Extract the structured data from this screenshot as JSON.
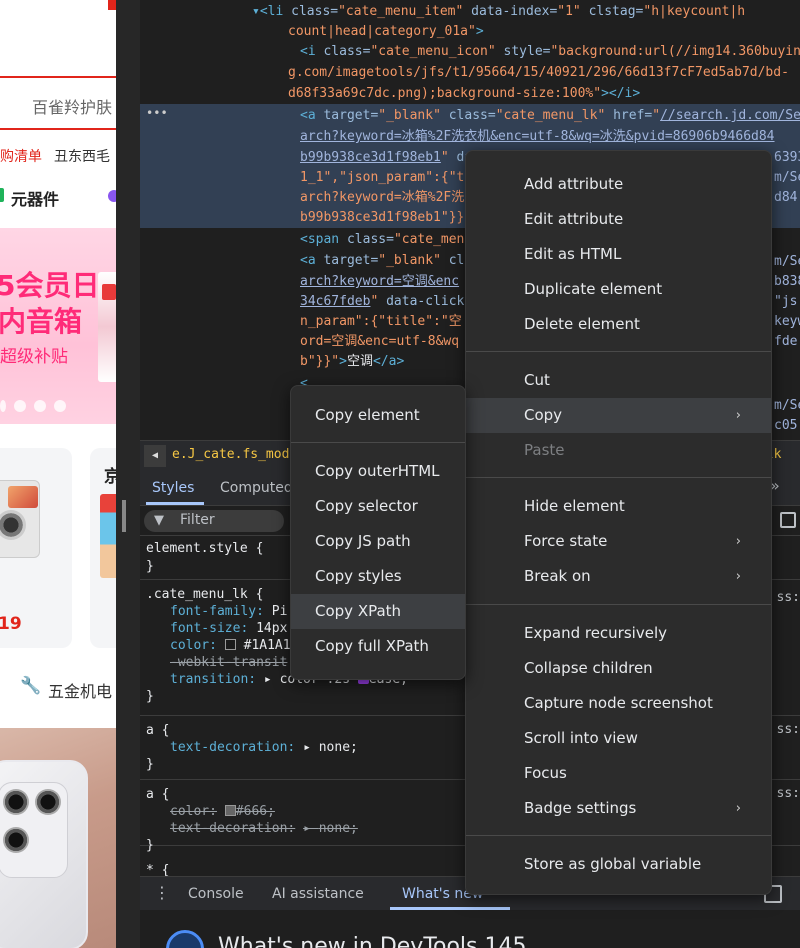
{
  "page": {
    "search_text": "百雀羚护肤",
    "hotword_red": "购清单",
    "hotword": "丑东西毛",
    "category_label": "元器件",
    "banner_line1": "5会员日",
    "banner_line2": "内音箱",
    "banner_line3": "超级补贴",
    "price": "19",
    "card2_title": "京",
    "tool_icon": "🔧",
    "tool_label": "五金机电"
  },
  "elements": {
    "lines": [
      {
        "html": "<span class='tag'>▾&lt;li</span> <span class='attr'>class=</span><span class='val'>\"cate_menu_item\"</span> <span class='attr'>data-index=</span><span class='val'>\"1\"</span> <span class='attr'>clstag=</span><span class='val'>\"h|keycount|h</span>"
      },
      {
        "html": "<span class='val'>count|head|category_01a\"</span><span class='tag'>&gt;</span>"
      },
      {
        "html": "<span class='tag'>&lt;i</span> <span class='attr'>class=</span><span class='val'>\"cate_menu_icon\"</span> <span class='attr'>style=</span><span class='val'>\"background:url(//img14.360buyin</span>"
      },
      {
        "html": "<span class='val'>g.com/imagetools/jfs/t1/95664/15/40921/296/66d13f7cF7ed5ab7d/bd-</span>"
      },
      {
        "html": "<span class='val'>d68f33a69c7dc.png);background-size:100%\"</span><span class='tag'>&gt;&lt;/i&gt;</span>"
      },
      {
        "html": "<span class='tag'>&lt;a</span> <span class='attr'>target=</span><span class='val'>\"_blank\"</span> <span class='attr'>class=</span><span class='val'>\"cate_menu_lk\"</span> <span class='attr'>href=</span><span class='val'>\"</span><span class='link'>//search.jd.com/Se</span>"
      },
      {
        "html": "<span class='link'>arch?keyword=冰箱%2F洗衣机&amp;enc=utf-8&amp;wq=冰洗&amp;pvid=86906b9466d84</span>"
      },
      {
        "html": "<span class='link'>b99b938ce3d1f98eb1</span><span class='val'>\"</span> <span class='attr'>da</span>"
      },
      {
        "html": "<span class='val'>1_1\",\"json_param\":{\"ti</span>"
      },
      {
        "html": "<span class='val'>arch?keyword=冰箱%2F洗</span>"
      },
      {
        "html": "<span class='val'>b99b938ce3d1f98eb1\"}}</span><span class='tag'>\"</span>"
      },
      {
        "html": "<span class='tag'>&lt;span</span> <span class='attr'>class=</span><span class='val'>\"cate_menu</span>"
      },
      {
        "html": "<span class='tag'>&lt;a</span> <span class='attr'>target=</span><span class='val'>\"_blank\"</span> <span class='attr'>cl</span>"
      },
      {
        "html": "<span class='link'>arch?keyword=空调&amp;enc</span>"
      },
      {
        "html": "<span class='link'>34c67fdeb</span><span class='val'>\"</span> <span class='attr'>data-click</span>"
      },
      {
        "html": "<span class='val'>n_param\":{\"title\":\"空</span>"
      },
      {
        "html": "<span class='val'>ord=空调&amp;enc=utf-8&amp;wq</span>"
      },
      {
        "html": "<span class='val'>b\"}}\"</span><span class='tag'>&gt;</span><span class='txt'>空调</span><span class='tag'>&lt;/a&gt;</span>"
      },
      {
        "html": "<span class='tag'>&lt;</span>"
      }
    ],
    "right_fragments": [
      "6393",
      "m/Se",
      "d84",
      "m/Se",
      "b838",
      "\"js",
      "keyw",
      "fde",
      "m/Se",
      "c05"
    ]
  },
  "breadcrumb": {
    "left": "e.J_cate.fs_mod.c",
    "right": "_lk"
  },
  "styles_tabs": {
    "styles": "Styles",
    "computed": "Computed",
    "more": "»"
  },
  "filter": {
    "placeholder": "Filter"
  },
  "rules": {
    "element_style": "element.style {",
    "close": "}",
    "cate_selector": ".cate_menu_lk {",
    "font_family_prop": "font-family:",
    "font_family_val": "Pi",
    "font_size_prop": "font-size:",
    "font_size_val": "14px",
    "color_prop": "color:",
    "color_val": "#1A1A1",
    "webkit_prop": "-webkit-transit",
    "transition_prop": "transition:",
    "transition_val": "color .2s",
    "ease_val": "ease;",
    "a_selector": "a {",
    "text_decoration_prop": "text-decoration:",
    "text_decoration_val": "none;",
    "color2_val": "#666;",
    "star_selector": "* {",
    "src_fragment": "ss:"
  },
  "drawer": {
    "console": "Console",
    "ai": "AI assistance",
    "whatsnew": "What's new",
    "title": "What's new in DevTools 145"
  },
  "context_menu": {
    "items": [
      "Add attribute",
      "Edit attribute",
      "Edit as HTML",
      "Duplicate element",
      "Delete element",
      "Cut",
      "Copy",
      "Paste",
      "Hide element",
      "Force state",
      "Break on",
      "Expand recursively",
      "Collapse children",
      "Capture node screenshot",
      "Scroll into view",
      "Focus",
      "Badge settings",
      "Store as global variable"
    ]
  },
  "copy_submenu": {
    "items": [
      "Copy element",
      "Copy outerHTML",
      "Copy selector",
      "Copy JS path",
      "Copy styles",
      "Copy XPath",
      "Copy full XPath"
    ]
  }
}
